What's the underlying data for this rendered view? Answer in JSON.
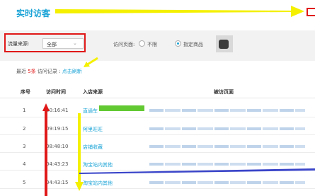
{
  "header": {
    "title": "实时访客"
  },
  "filter": {
    "source_label": "流量来源:",
    "source_value": "全部",
    "page_label": "访问页面:",
    "radio_unlimited": "不限",
    "radio_product": "指定商品"
  },
  "recent": {
    "prefix": "最近",
    "count": "5条",
    "suffix": "访问记录",
    "separator": ":",
    "refresh": "点击刷新"
  },
  "table": {
    "headers": [
      "序号",
      "访问时间",
      "入店来源",
      "被访页面"
    ],
    "rows": [
      {
        "no": "1",
        "time": "00:16:41",
        "source": "直通车"
      },
      {
        "no": "2",
        "time": "09:19:15",
        "source": "阿里旺旺"
      },
      {
        "no": "3",
        "time": "08:48:10",
        "source": "店铺收藏"
      },
      {
        "no": "4",
        "time": "04:43:23",
        "source": "淘宝站内其他"
      },
      {
        "no": "5",
        "time": "04:43:15",
        "source": "淘宝站内其他"
      }
    ]
  },
  "colors": {
    "accent": "#1aa3d6",
    "annotation_red": "#e01818",
    "annotation_yellow": "#f4f000",
    "annotation_green": "#63c932",
    "annotation_blue": "#3a45c9"
  }
}
